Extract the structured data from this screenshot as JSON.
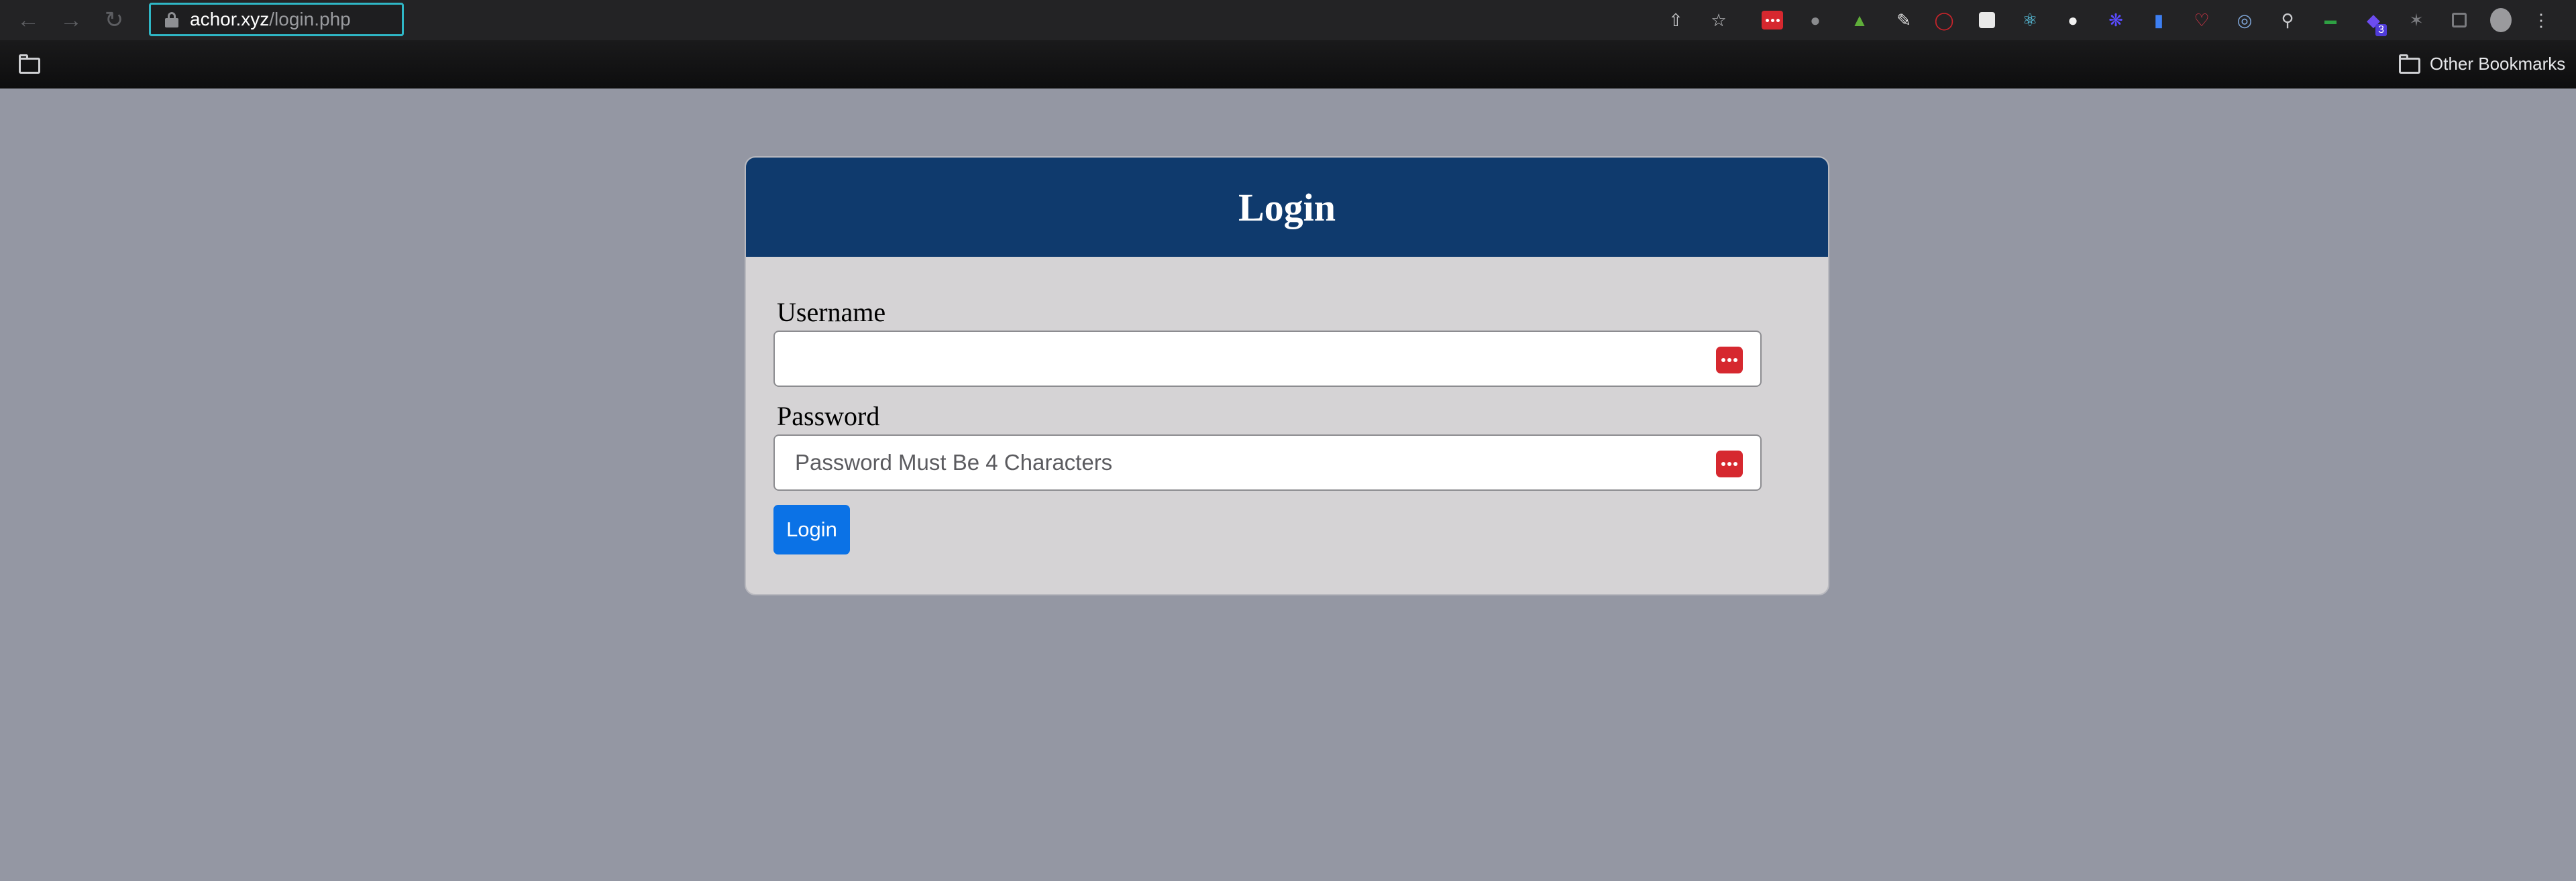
{
  "browser": {
    "url_host": "achor.xyz",
    "url_path": "/login.php",
    "nav": {
      "back_icon": "arrow-left-icon",
      "forward_icon": "arrow-right-icon",
      "reload_icon": "reload-icon"
    },
    "toolbar_icons": [
      "share-icon",
      "bookmark-star-icon",
      "password-manager-extension-icon",
      "extension-icon",
      "tree-extension-icon",
      "pen-extension-icon",
      "ublock-icon",
      "trello-extension-icon",
      "react-devtools-icon",
      "extension-icon",
      "extension-icon",
      "extension-icon",
      "pocket-icon",
      "extension-icon",
      "search-extension-icon",
      "extension-icon",
      "extension-icon",
      "puzzle-extensions-icon",
      "side-panel-icon",
      "profile-avatar-icon",
      "more-menu-icon"
    ],
    "extension_badge": "3",
    "other_bookmarks_label": "Other Bookmarks"
  },
  "login": {
    "title": "Login",
    "username_label": "Username",
    "username_value": "",
    "password_label": "Password",
    "password_placeholder": "Password Must Be 4 Characters",
    "submit_label": "Login"
  },
  "colors": {
    "page_background": "#9497a3",
    "card_header": "#0f3a6d",
    "card_body": "#d5d3d5",
    "button": "#0b72e6",
    "password_manager_icon": "#d6282f"
  }
}
